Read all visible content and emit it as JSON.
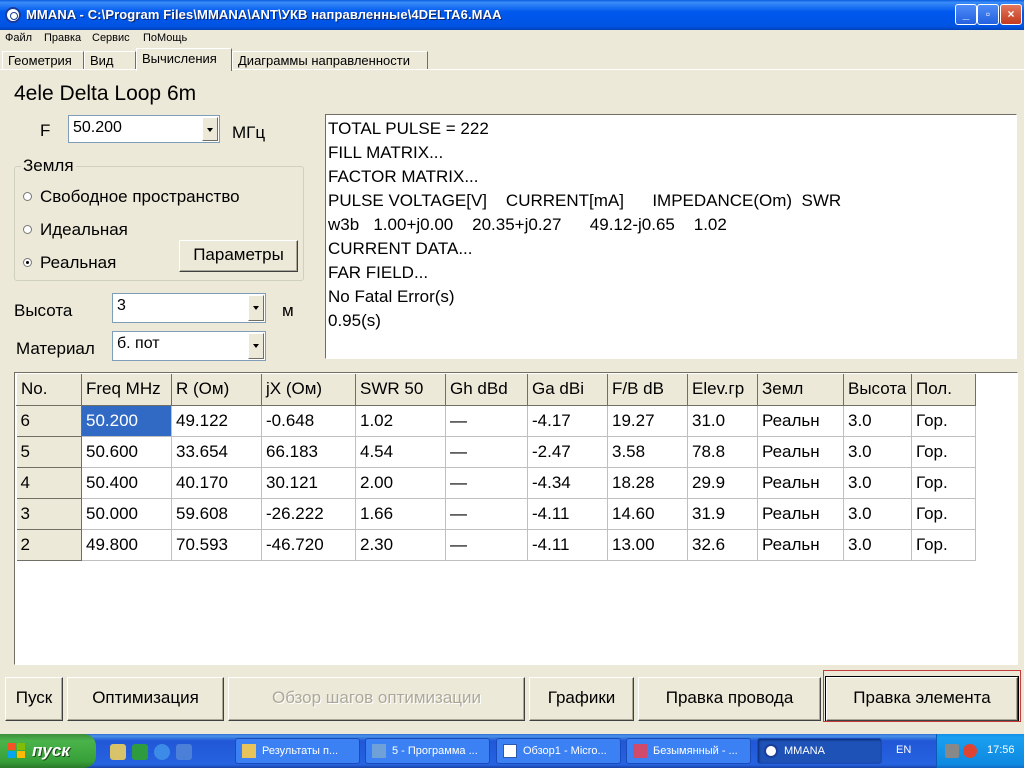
{
  "window": {
    "title": "MMANA - C:\\Program Files\\MMANA\\ANT\\УКВ направленные\\4DELTA6.MAA",
    "controls": [
      "_",
      "▫",
      "×"
    ]
  },
  "menu": [
    "Файл",
    "Правка",
    "Сервис",
    "ПоМощь"
  ],
  "tabs": [
    "Геометрия",
    "Вид",
    "Вычисления",
    "Диаграммы направленности"
  ],
  "active_tab": "Вычисления",
  "antenna_name": "4ele Delta Loop 6m",
  "freq": {
    "label": "F",
    "value": "50.200",
    "unit": "МГц"
  },
  "ground": {
    "legend": "Земля",
    "options": [
      "Свободное пространство",
      "Идеальная",
      "Реальная"
    ],
    "selected": "Реальная",
    "params_button": "Параметры"
  },
  "height": {
    "label": "Высота",
    "value": "3",
    "unit": "м"
  },
  "material": {
    "label": "Материал",
    "value": "б. пот"
  },
  "output_lines": [
    "TOTAL PULSE = 222",
    "FILL MATRIX...",
    "FACTOR MATRIX...",
    "PULSE VOLTAGE[V]    CURRENT[mA]      IMPEDANCE(Om)  SWR",
    "w3b   1.00+j0.00    20.35+j0.27      49.12-j0.65    1.02",
    "CURRENT DATA...",
    "FAR FIELD...",
    "No Fatal Error(s)",
    "0.95(s)"
  ],
  "table": {
    "headers": [
      "No.",
      "Freq MHz",
      "R (Ом)",
      "jX (Ом)",
      "SWR 50",
      "Gh dBd",
      "Ga dBi",
      "F/B dB",
      "Elev.гр",
      "Земл",
      "Высота",
      "Пол."
    ],
    "rows": [
      [
        "6",
        "50.200",
        "49.122",
        "-0.648",
        "1.02",
        "—",
        "-4.17",
        "19.27",
        "31.0",
        "Реальн",
        "3.0",
        "Гор."
      ],
      [
        "5",
        "50.600",
        "33.654",
        "66.183",
        "4.54",
        "—",
        "-2.47",
        "3.58",
        "78.8",
        "Реальн",
        "3.0",
        "Гор."
      ],
      [
        "4",
        "50.400",
        "40.170",
        "30.121",
        "2.00",
        "—",
        "-4.34",
        "18.28",
        "29.9",
        "Реальн",
        "3.0",
        "Гор."
      ],
      [
        "3",
        "50.000",
        "59.608",
        "-26.222",
        "1.66",
        "—",
        "-4.11",
        "14.60",
        "31.9",
        "Реальн",
        "3.0",
        "Гор."
      ],
      [
        "2",
        "49.800",
        "70.593",
        "-46.720",
        "2.30",
        "—",
        "-4.11",
        "13.00",
        "32.6",
        "Реальн",
        "3.0",
        "Гор."
      ]
    ]
  },
  "buttons": {
    "start": "Пуск",
    "optimize": "Оптимизация",
    "opt_steps": "Обзор шагов оптимизации",
    "graphs": "Графики",
    "edit_wire": "Правка провода",
    "edit_element": "Правка элемента"
  },
  "taskbar": {
    "start": "пуск",
    "tasks": [
      "Результаты п...",
      "5 - Программа ...",
      "Обзор1 - Micro...",
      "Безымянный - ...",
      "MMANA"
    ],
    "lang": "EN",
    "clock": "17:56"
  }
}
